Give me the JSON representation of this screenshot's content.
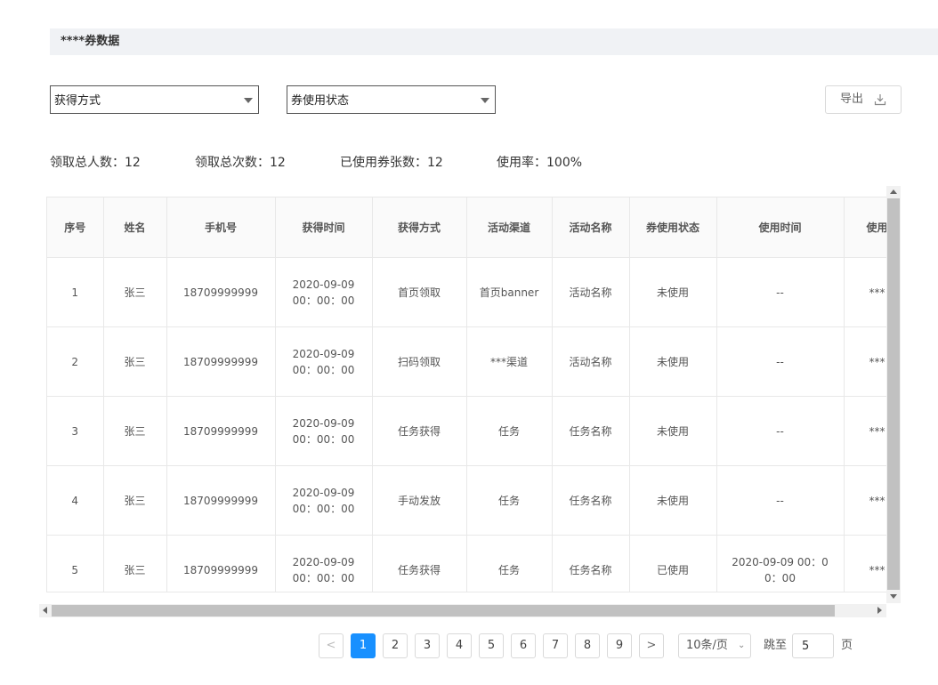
{
  "section": {
    "title": "****券数据"
  },
  "filters": {
    "acquire_method": "获得方式",
    "usage_status": "券使用状态",
    "export_label": "导出"
  },
  "stats": [
    {
      "label": "领取总人数",
      "value": "12"
    },
    {
      "label": "领取总次数",
      "value": "12"
    },
    {
      "label": "已使用券张数",
      "value": "12"
    },
    {
      "label": "使用率",
      "value": "100%"
    }
  ],
  "table": {
    "columns": [
      "序号",
      "姓名",
      "手机号",
      "获得时间",
      "获得方式",
      "活动渠道",
      "活动名称",
      "券使用状态",
      "使用时间",
      "使用"
    ],
    "rows": [
      [
        "1",
        "张三",
        "18709999999",
        "2020-09-09 00：00：00",
        "首页领取",
        "首页banner",
        "活动名称",
        "未使用",
        "--",
        "***|"
      ],
      [
        "2",
        "张三",
        "18709999999",
        "2020-09-09 00：00：00",
        "扫码领取",
        "***渠道",
        "活动名称",
        "未使用",
        "--",
        "***|"
      ],
      [
        "3",
        "张三",
        "18709999999",
        "2020-09-09 00：00：00",
        "任务获得",
        "任务",
        "任务名称",
        "未使用",
        "--",
        "***|"
      ],
      [
        "4",
        "张三",
        "18709999999",
        "2020-09-09 00：00：00",
        "手动发放",
        "任务",
        "任务名称",
        "未使用",
        "--",
        "***|"
      ],
      [
        "5",
        "张三",
        "18709999999",
        "2020-09-09 00：00：00",
        "任务获得",
        "任务",
        "任务名称",
        "已使用",
        "2020-09-09 00：00：00",
        "***|"
      ]
    ]
  },
  "pagination": {
    "prev": "<",
    "next": ">",
    "pages": [
      "1",
      "2",
      "3",
      "4",
      "5",
      "6",
      "7",
      "8",
      "9"
    ],
    "current": "1",
    "page_size": "10条/页",
    "jump_label": "跳至",
    "jump_value": "5",
    "page_unit": "页"
  },
  "colors": {
    "accent": "#1890ff",
    "header_bg": "#f0f2f5",
    "table_header_bg": "#fafafa"
  },
  "icons": {
    "select_arrow": "caret-down-icon",
    "export": "download-icon",
    "size_chevron": "chevron-down-icon"
  }
}
